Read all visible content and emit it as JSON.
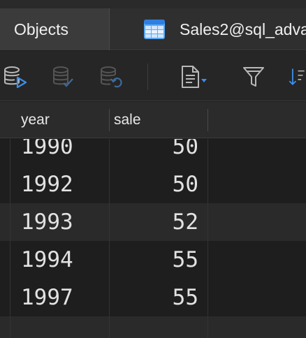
{
  "tabs": {
    "objects_label": "Objects",
    "query_label": "Sales2@sql_adva"
  },
  "toolbar": {
    "icons": [
      "db-run-icon",
      "db-check-icon",
      "db-revert-icon",
      "document-icon",
      "filter-icon",
      "sort-icon"
    ],
    "accent_color": "#3d8ee8"
  },
  "grid": {
    "columns": [
      "year",
      "sale"
    ],
    "rows": [
      {
        "year": "1990",
        "sale": "50"
      },
      {
        "year": "1992",
        "sale": "50"
      },
      {
        "year": "1993",
        "sale": "52"
      },
      {
        "year": "1994",
        "sale": "55"
      },
      {
        "year": "1997",
        "sale": "55"
      }
    ]
  }
}
